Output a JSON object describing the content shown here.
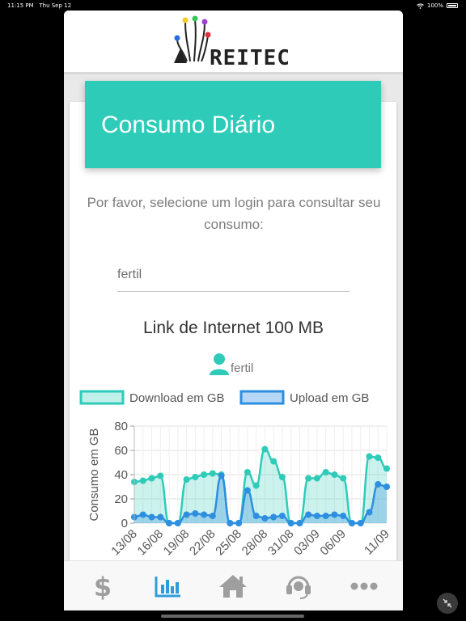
{
  "status_bar": {
    "time": "11:15 PM",
    "date": "Thu Sep 12",
    "battery": "100%"
  },
  "header": {
    "logo_text": "REITEC"
  },
  "card": {
    "title": "Consumo Diário",
    "instructions": "Por favor, selecione um login para consultar seu consumo:",
    "login_value": "fertil"
  },
  "chart_section": {
    "title": "Link de Internet 100 MB",
    "user_name": "fertil"
  },
  "colors": {
    "accent": "#2ecbb9",
    "download": "#2ecbb9",
    "upload": "#2e8ee0",
    "nav_active": "#2e9cdb",
    "nav_inactive": "#9e9e9e"
  },
  "chart_data": {
    "type": "area",
    "ylabel": "Consumo em GB",
    "ylim": [
      0,
      80
    ],
    "yticks": [
      0,
      20,
      40,
      60,
      80
    ],
    "xticks": [
      "13/08",
      "16/08",
      "19/08",
      "22/08",
      "25/08",
      "28/08",
      "31/08",
      "03/09",
      "06/09",
      "11/09"
    ],
    "grid": true,
    "legend_position": "top",
    "series": [
      {
        "name": "Download em GB",
        "values": [
          34,
          35,
          37,
          39,
          0,
          0,
          36,
          38,
          40,
          41,
          40,
          0,
          0,
          42,
          31,
          61,
          51,
          38,
          0,
          0,
          37,
          37,
          42,
          40,
          37,
          0,
          0,
          55,
          54,
          45
        ]
      },
      {
        "name": "Upload em GB",
        "values": [
          5,
          7,
          5,
          5,
          0,
          0,
          7,
          8,
          7,
          6,
          39,
          0,
          0,
          27,
          6,
          4,
          5,
          6,
          0,
          0,
          7,
          6,
          6,
          7,
          6,
          0,
          0,
          9,
          32,
          30
        ]
      }
    ]
  },
  "nav": {
    "items": [
      {
        "icon": "dollar-icon",
        "active": false
      },
      {
        "icon": "bar-chart-icon",
        "active": true
      },
      {
        "icon": "home-icon",
        "active": false
      },
      {
        "icon": "headset-icon",
        "active": false
      },
      {
        "icon": "more-icon",
        "active": false
      }
    ]
  }
}
